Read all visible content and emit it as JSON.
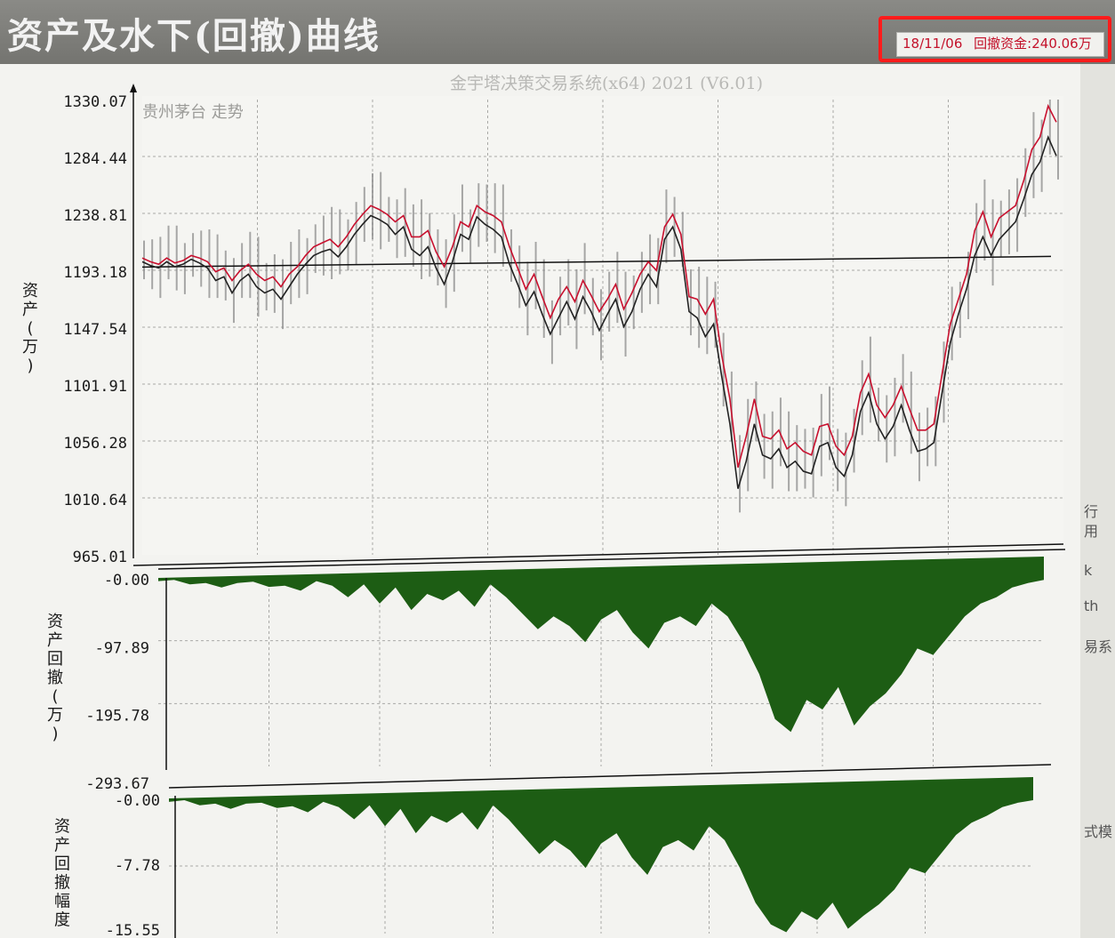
{
  "window": {
    "title": "资产及水下(回撤)曲线"
  },
  "status": {
    "date": "18/11/06",
    "label": "回撤资金",
    "value": "240.06万"
  },
  "chart_data": [
    {
      "type": "line",
      "title": "金宇塔决策交易系统(x64) 2021 (V6.01)",
      "subtitle": "贵州茅台 走势",
      "ylabel": "资产(万)",
      "ylim": [
        965.01,
        1330.07
      ],
      "yticks": [
        "1330.07",
        "1284.44",
        "1238.81",
        "1193.18",
        "1147.54",
        "1101.91",
        "1056.28",
        "1010.64",
        "965.01"
      ],
      "grid": true,
      "baseline": 1200,
      "colors": {
        "asset": "#c8102e",
        "price": "#222222",
        "bars": "#8c8c8c",
        "baseline": "#111111"
      },
      "series": [
        {
          "values": [
            1203,
            1200,
            1198,
            1203,
            1199,
            1201,
            1205,
            1203,
            1200,
            1192,
            1195,
            1185,
            1193,
            1198,
            1190,
            1185,
            1188,
            1180,
            1190,
            1196,
            1205,
            1212,
            1215,
            1218,
            1212,
            1220,
            1230,
            1238,
            1245,
            1242,
            1238,
            1232,
            1237,
            1220,
            1220,
            1225,
            1208,
            1196,
            1212,
            1232,
            1228,
            1245,
            1240,
            1237,
            1232,
            1212,
            1195,
            1178,
            1190,
            1172,
            1155,
            1170,
            1180,
            1168,
            1185,
            1173,
            1160,
            1170,
            1182,
            1162,
            1175,
            1190,
            1200,
            1193,
            1228,
            1238,
            1222,
            1172,
            1170,
            1158,
            1170,
            1125,
            1090,
            1035,
            1060,
            1090,
            1060,
            1058,
            1065,
            1050,
            1055,
            1048,
            1045,
            1068,
            1070,
            1052,
            1045,
            1060,
            1095,
            1110,
            1085,
            1075,
            1085,
            1100,
            1082,
            1065,
            1065,
            1070,
            1110,
            1150,
            1170,
            1190,
            1225,
            1240,
            1220,
            1235,
            1240,
            1245,
            1265,
            1290,
            1300,
            1325,
            1312
          ]
        },
        {
          "values": [
            1200,
            1197,
            1195,
            1200,
            1196,
            1198,
            1202,
            1199,
            1195,
            1185,
            1188,
            1175,
            1185,
            1190,
            1180,
            1175,
            1178,
            1170,
            1180,
            1190,
            1198,
            1205,
            1208,
            1210,
            1204,
            1212,
            1222,
            1230,
            1237,
            1234,
            1230,
            1222,
            1228,
            1210,
            1205,
            1212,
            1195,
            1182,
            1200,
            1222,
            1218,
            1236,
            1230,
            1226,
            1220,
            1198,
            1182,
            1165,
            1176,
            1158,
            1142,
            1155,
            1168,
            1154,
            1172,
            1160,
            1145,
            1158,
            1170,
            1148,
            1160,
            1178,
            1190,
            1180,
            1218,
            1228,
            1210,
            1160,
            1155,
            1140,
            1150,
            1108,
            1070,
            1018,
            1040,
            1070,
            1045,
            1042,
            1050,
            1035,
            1040,
            1032,
            1030,
            1052,
            1055,
            1035,
            1028,
            1045,
            1080,
            1095,
            1070,
            1058,
            1068,
            1085,
            1065,
            1048,
            1050,
            1055,
            1095,
            1135,
            1158,
            1178,
            1205,
            1220,
            1205,
            1218,
            1225,
            1232,
            1250,
            1270,
            1280,
            1300,
            1285
          ]
        }
      ]
    },
    {
      "type": "area",
      "ylabel": "资产回撤(万)",
      "ylim": [
        -293.67,
        0.0
      ],
      "yticks": [
        "-0.00",
        "-97.89",
        "-195.78",
        "-293.67"
      ],
      "grid": true,
      "colors": {
        "fill": "#1d5d14"
      },
      "values": [
        -5,
        -3,
        -10,
        -8,
        -15,
        -8,
        -6,
        -14,
        -12,
        -20,
        -5,
        -12,
        -30,
        -10,
        -40,
        -15,
        -50,
        -25,
        -35,
        -20,
        -45,
        -10,
        -30,
        -55,
        -80,
        -60,
        -75,
        -100,
        -65,
        -50,
        -85,
        -110,
        -70,
        -60,
        -75,
        -40,
        -60,
        -100,
        -150,
        -220,
        -240,
        -190,
        -205,
        -170,
        -230,
        -200,
        -180,
        -150,
        -110,
        -120,
        -90,
        -60,
        -40,
        -30,
        -15,
        -8,
        -3
      ]
    },
    {
      "type": "area",
      "ylabel": "资产回撤幅度",
      "ylim": [
        -15.55,
        0.0
      ],
      "yticks": [
        "-0.00",
        "-7.78",
        "-15.55"
      ],
      "grid": true,
      "colors": {
        "fill": "#1d5d14"
      },
      "values": [
        -0.4,
        -0.2,
        -0.8,
        -0.6,
        -1.2,
        -0.6,
        -0.5,
        -1.1,
        -0.9,
        -1.6,
        -0.4,
        -1.0,
        -2.4,
        -0.8,
        -3.2,
        -1.2,
        -4.0,
        -2.0,
        -2.8,
        -1.6,
        -3.6,
        -0.8,
        -2.4,
        -4.4,
        -6.4,
        -4.8,
        -6.0,
        -8.0,
        -5.2,
        -4.0,
        -6.8,
        -8.8,
        -5.6,
        -4.8,
        -6.0,
        -3.2,
        -4.8,
        -8.0,
        -12.0,
        -14.5,
        -15.4,
        -13.0,
        -14.0,
        -12.0,
        -15.0,
        -13.5,
        -12.2,
        -10.5,
        -8.0,
        -8.6,
        -6.4,
        -4.2,
        -2.8,
        -2.0,
        -1.0,
        -0.5,
        -0.2
      ]
    }
  ],
  "right_strip": {
    "fragments": [
      "行",
      "用",
      "k",
      "th",
      "易系",
      "式模"
    ]
  }
}
